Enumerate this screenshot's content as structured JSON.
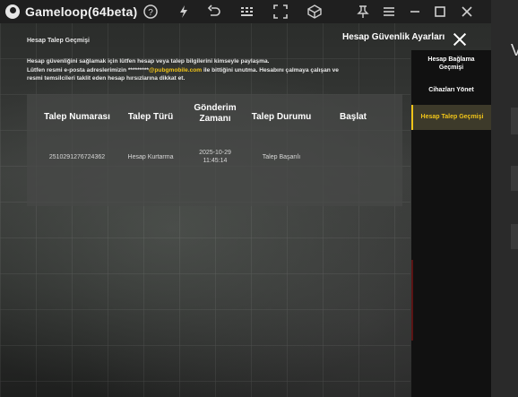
{
  "window": {
    "title": "Gameloop(64beta)",
    "toolbar_icons": [
      "help-icon",
      "boost-icon",
      "back-icon",
      "keyboard-icon",
      "fullscreen-icon",
      "cube-icon",
      "pin-icon",
      "menu-icon",
      "minimize-icon",
      "maximize-icon",
      "close-icon"
    ]
  },
  "panel": {
    "heading": "Hesap Talep Geçmişi",
    "section_title": "Hesap Güvenlik Ayarları",
    "desc_line1": "Hesap güvenliğini sağlamak için lütfen hesap veya talep bilgilerini kimseyle paylaşma.",
    "desc_line2_a": "Lütfen resmi e-posta adreslerimizin *********",
    "desc_line2_email": "@pubgmobile.com",
    "desc_line2_b": " ile bittiğini unutma. Hesabını çalmaya çalışan ve",
    "desc_line3": "resmi temsilcileri taklit eden hesap hırsızlarına dikkat et."
  },
  "table": {
    "headers": {
      "request_no": "Talep Numarası",
      "request_type": "Talep Türü",
      "sent_time_1": "Gönderim",
      "sent_time_2": "Zamanı",
      "status": "Talep Durumu",
      "start": "Başlat"
    },
    "rows": [
      {
        "request_no": "2510291276724362",
        "request_type": "Hesap Kurtarma",
        "date": "2025-10-29",
        "time": "11:45:14",
        "status": "Talep Başarılı"
      }
    ]
  },
  "sidebar": {
    "items": [
      {
        "line1": "Hesap Bağlama",
        "line2": "Geçmişi"
      },
      {
        "line1": "Cihazları Yönet"
      },
      {
        "line1": "Hesap Talep Geçmişi"
      }
    ]
  },
  "right_strip": {
    "label": "V"
  },
  "colors": {
    "accent": "#f0c419",
    "bg": "#1f1f1f"
  }
}
